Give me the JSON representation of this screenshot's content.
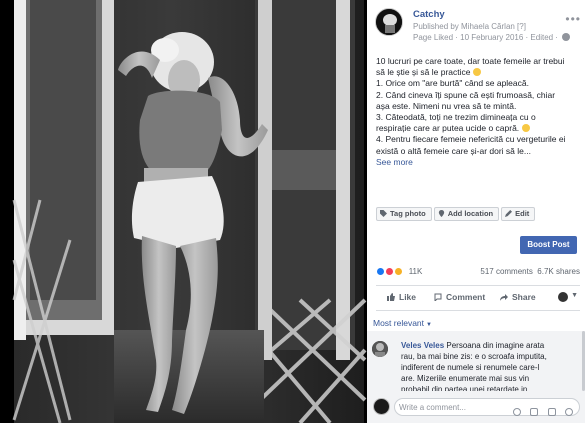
{
  "post": {
    "page_name": "Catchy",
    "published_by": "Published by Mihaela Cărlan [?]",
    "meta": "Page Liked · 10 February 2016 · Edited ·",
    "text_lines": [
      "10 lucruri pe care toate, dar toate femeile ar trebui",
      "să le știe și să le practice",
      "1. Orice om \"are burtă\" când se apleacă.",
      "2. Când cineva îți spune că ești frumoasă, chiar",
      "așa este. Nimeni nu vrea să te mintă.",
      "3. Căteodată, toți ne trezim dimineața cu o",
      "respirație care ar putea ucide o capră.",
      "4. Pentru fiecare femeie nefericită cu vergeturile ei",
      "există o altă femeie care și-ar dori să le..."
    ],
    "see_more": "See more"
  },
  "tag_actions": {
    "tag_photo": "Tag photo",
    "add_location": "Add location",
    "edit": "Edit"
  },
  "boost_button": "Boost Post",
  "stats": {
    "reaction_count": "11K",
    "comments": "517 comments",
    "shares": "6.7K shares"
  },
  "actions": {
    "like": "Like",
    "comment": "Comment",
    "share": "Share"
  },
  "sort": {
    "label": "Most relevant"
  },
  "comment": {
    "author": "Veles Veles",
    "lines": [
      "Persoana din imagine arata",
      "rau, ba mai bine zis: e o scroafa imputita,",
      "indiferent de numele si renumele care-l",
      "are. Mizeriile enumerate mai sus vin",
      "probabil din partea unei retardate in"
    ]
  },
  "composer": {
    "placeholder": "Write a comment..."
  },
  "colors": {
    "link": "#385898",
    "boost": "#4267b2",
    "muted": "#90949c"
  },
  "icons": [
    "globe-icon",
    "more-options-icon",
    "tag-icon",
    "location-icon",
    "edit-icon",
    "like-reaction-icon",
    "love-reaction-icon",
    "wow-reaction-icon",
    "like-icon",
    "comment-icon",
    "share-icon",
    "emoji-icon",
    "camera-icon",
    "gif-icon",
    "sticker-icon"
  ]
}
